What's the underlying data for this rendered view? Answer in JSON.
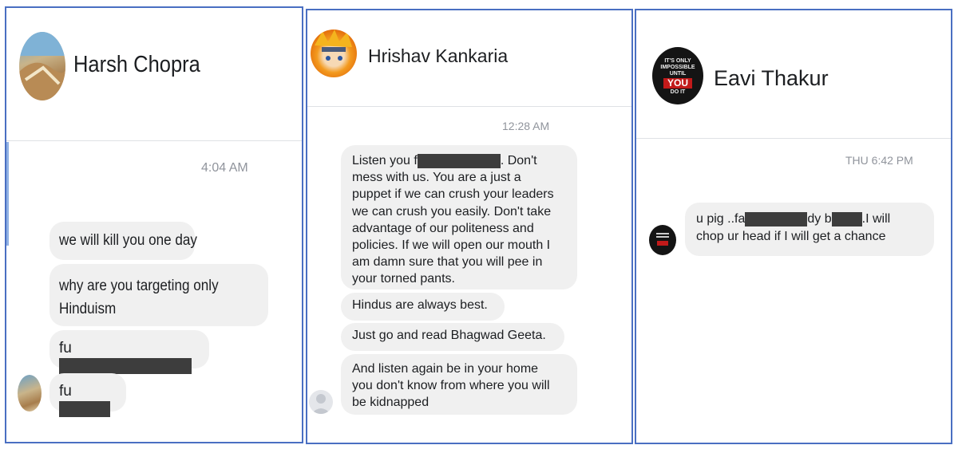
{
  "panels": [
    {
      "contact_name": "Harsh Chopra",
      "timestamp": "4:04 AM",
      "messages": [
        "we will kill you one day",
        "why are you targeting only\nHinduism",
        "fu",
        "fu"
      ]
    },
    {
      "contact_name": "Hrishav Kankaria",
      "timestamp": "12:28 AM",
      "messages": [
        {
          "before": "Listen you f",
          "after": ". Don't\nmess with us. You are a just a\npuppet if we can crush your leaders\nwe can crush you easily. Don't take\nadvantage of our politeness and\npolicies. If we will open our mouth I\nam damn sure that you will pee in\nyour torned pants."
        },
        "Hindus are always best.",
        "Just go and read Bhagwad Geeta.",
        "And listen again be in your home\nyou don't know from where you will\nbe kidnapped"
      ]
    },
    {
      "contact_name": "Eavi Thakur",
      "timestamp": "THU 6:42 PM",
      "avatar_text": [
        "IT'S ONLY",
        "IMPOSSIBLE",
        "UNTIL",
        "YOU",
        "DO IT"
      ],
      "messages": [
        {
          "p1": "u pig ..fa",
          "p2": "dy b",
          "p3": ".I will",
          "line2": "chop ur head if I will get a chance"
        }
      ]
    }
  ],
  "colors": {
    "panel_border": "#4a6fc2",
    "bubble_bg": "#f0f0f0",
    "redaction": "#3d3d3d",
    "timestamp": "#90949c"
  }
}
